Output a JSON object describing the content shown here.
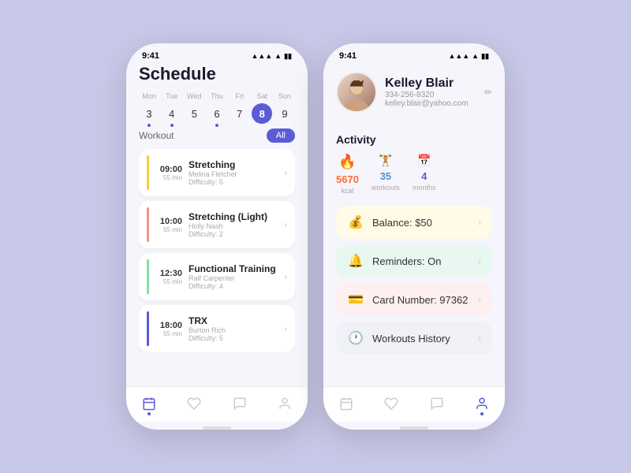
{
  "background": "#c8c8e8",
  "accent": "#5b5bd6",
  "phone1": {
    "statusTime": "9:41",
    "title": "Schedule",
    "calendarDays": [
      "Mon",
      "Tue",
      "Wed",
      "Thu",
      "Fri",
      "Sat",
      "Sun"
    ],
    "calendarDates": [
      {
        "num": "3",
        "active": false,
        "dot": true
      },
      {
        "num": "4",
        "active": false,
        "dot": true
      },
      {
        "num": "5",
        "active": false,
        "dot": false
      },
      {
        "num": "6",
        "active": false,
        "dot": true
      },
      {
        "num": "7",
        "active": false,
        "dot": false
      },
      {
        "num": "8",
        "active": true,
        "dot": false
      },
      {
        "num": "9",
        "active": false,
        "dot": false
      }
    ],
    "filterLabel": "Workout",
    "filterBtn": "All",
    "workouts": [
      {
        "time": "09:00",
        "duration": "55 min",
        "name": "Stretching",
        "trainer": "Melina Fletcher",
        "difficulty": "Difficulty: 5",
        "color": "#f4d03f"
      },
      {
        "time": "10:00",
        "duration": "55 min",
        "name": "Stretching (Light)",
        "trainer": "Holly Nash",
        "difficulty": "Difficulty: 2",
        "color": "#f1948a"
      },
      {
        "time": "12:30",
        "duration": "55 min",
        "name": "Functional Training",
        "trainer": "Ralf Carpenter",
        "difficulty": "Difficulty: 4",
        "color": "#82e0aa"
      },
      {
        "time": "18:00",
        "duration": "55 min",
        "name": "TRX",
        "trainer": "Burton Rich",
        "difficulty": "Difficulty: 5",
        "color": "#5b5bd6"
      }
    ],
    "nav": [
      "calendar",
      "heart",
      "chat",
      "person"
    ]
  },
  "phone2": {
    "statusTime": "9:41",
    "profile": {
      "name": "Kelley Blair",
      "phone": "334-256-8320",
      "email": "kelley.blair@yahoo.com"
    },
    "activity": {
      "title": "Activity",
      "stats": [
        {
          "icon": "🔥",
          "value": "5670",
          "label": "kcal",
          "colorClass": "orange"
        },
        {
          "icon": "🏋",
          "value": "35",
          "label": "workouts",
          "colorClass": "blue"
        },
        {
          "icon": "📅",
          "value": "4",
          "label": "months",
          "colorClass": "purple"
        }
      ]
    },
    "menuCards": [
      {
        "label": "Balance: $50",
        "icon": "💰",
        "bg": "yellow"
      },
      {
        "label": "Reminders: On",
        "icon": "🔔",
        "bg": "green"
      },
      {
        "label": "Card Number: 97362",
        "icon": "💳",
        "bg": "pink"
      },
      {
        "label": "Workouts History",
        "icon": "🕐",
        "bg": "gray"
      }
    ],
    "nav": [
      "calendar",
      "heart",
      "chat",
      "person"
    ]
  }
}
